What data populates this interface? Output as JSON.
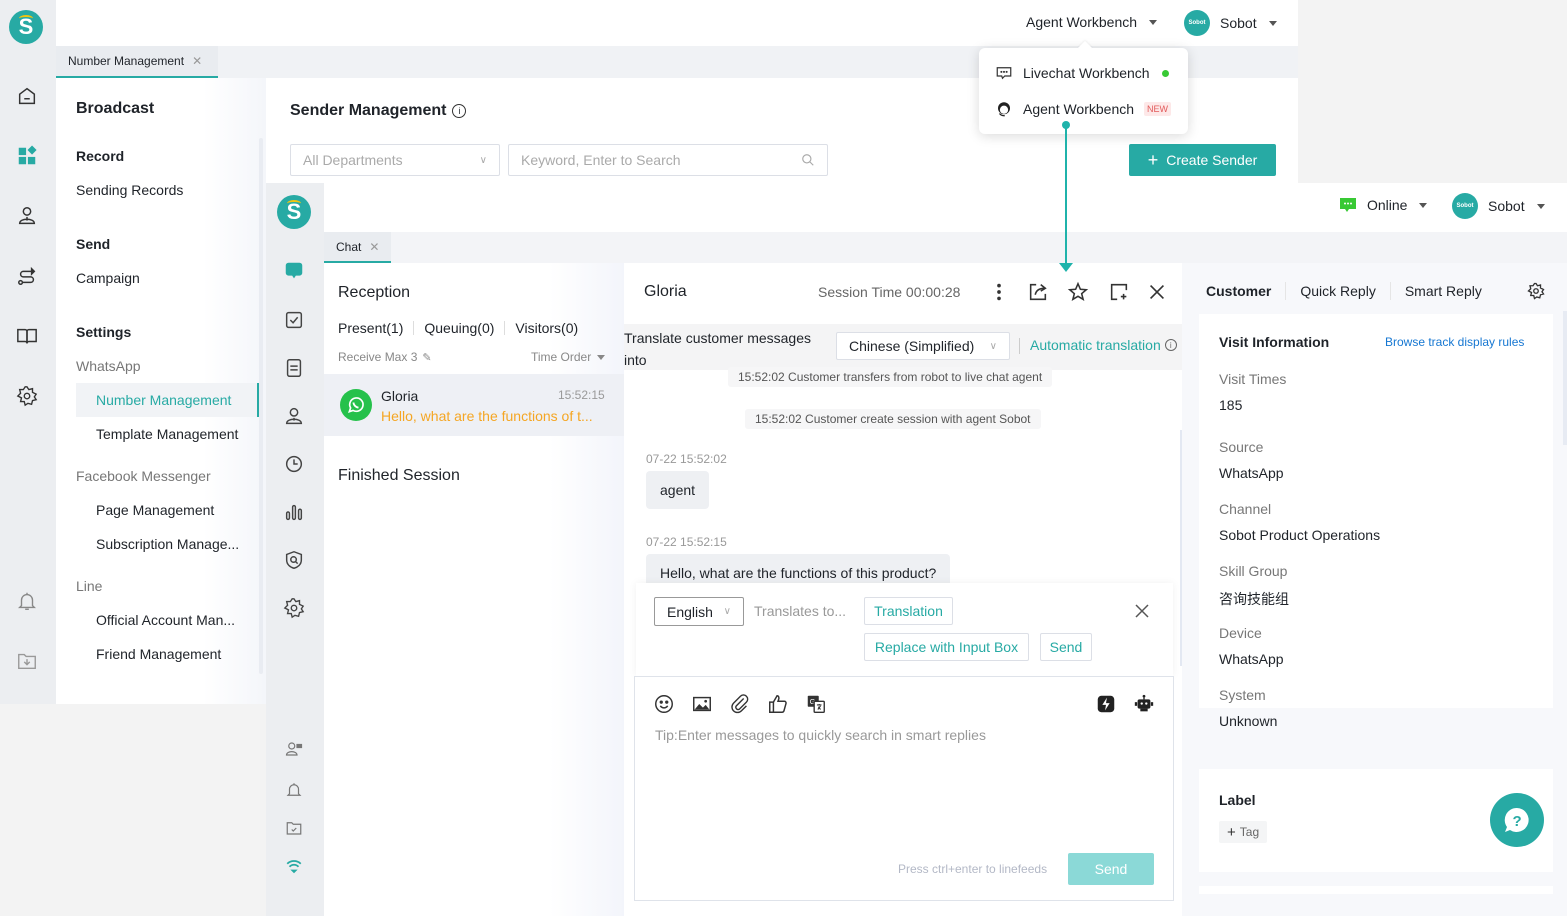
{
  "back_app": {
    "logo_letter": "S",
    "header": {
      "workspace_switch": "Agent Workbench",
      "user_name": "Sobot",
      "avatar_text": "Sobot"
    },
    "tab": {
      "label": "Number Management"
    },
    "nav": {
      "title": "Broadcast",
      "sections": [
        {
          "label": "Record",
          "items": [
            "Sending Records"
          ]
        },
        {
          "label": "Send",
          "items": [
            "Campaign"
          ]
        },
        {
          "label": "Settings"
        }
      ],
      "groups": [
        {
          "label": "WhatsApp",
          "items": [
            {
              "label": "Number Management",
              "active": true
            },
            {
              "label": "Template Management"
            }
          ]
        },
        {
          "label": "Facebook Messenger",
          "items": [
            {
              "label": "Page Management"
            },
            {
              "label": "Subscription Manage..."
            }
          ]
        },
        {
          "label": "Line",
          "items": [
            {
              "label": "Official Account Man..."
            },
            {
              "label": "Friend Management"
            }
          ]
        }
      ]
    },
    "rail_icons": [
      "home-icon",
      "apps-icon",
      "contacts-icon",
      "route-icon",
      "book-icon",
      "settings-icon",
      "bell-icon",
      "download-folder-icon"
    ],
    "main": {
      "title": "Sender Management",
      "department_select": "All Departments",
      "search_placeholder": "Keyword, Enter to Search",
      "create_button": "Create Sender"
    },
    "workspace_menu": {
      "items": [
        {
          "label": "Livechat Workbench",
          "status": "online"
        },
        {
          "label": "Agent Workbench",
          "badge": "NEW"
        }
      ]
    }
  },
  "workbench": {
    "logo_letter": "S",
    "header": {
      "status": "Online",
      "user_name": "Sobot",
      "avatar_text": "Sobot"
    },
    "tab": {
      "label": "Chat"
    },
    "reception": {
      "title": "Reception",
      "tabs": [
        "Present(1)",
        "Queuing(0)",
        "Visitors(0)"
      ],
      "receive_max": "Receive Max 3",
      "order": "Time Order",
      "sessions": [
        {
          "name": "Gloria",
          "time": "15:52:15",
          "preview": "Hello, what are the functions of t..."
        }
      ],
      "finished_title": "Finished Session"
    },
    "chat": {
      "customer_name": "Gloria",
      "session_time": "Session Time 00:00:28",
      "translate_label": "Translate customer messages into",
      "translate_target": "Chinese (Simplified)",
      "auto_translation": "Automatic translation",
      "system_messages": [
        "15:52:02 Customer transfers from robot to live chat agent",
        "15:52:02 Customer create session with agent Sobot"
      ],
      "messages": [
        {
          "time": "07-22 15:52:02",
          "text": "agent"
        },
        {
          "time": "07-22 15:52:15",
          "text": "Hello, what are the functions of this product?"
        }
      ],
      "translation_panel": {
        "source_lang": "English",
        "placeholder": "Translates to...",
        "translate_button": "Translation",
        "replace_button": "Replace with Input Box",
        "send_button": "Send"
      },
      "composer": {
        "placeholder": "Tip:Enter messages to quickly search in smart replies",
        "hint": "Press ctrl+enter to linefeeds",
        "send_button": "Send"
      }
    },
    "side": {
      "tabs": [
        "Customer",
        "Quick Reply",
        "Smart Reply"
      ],
      "visit": {
        "title": "Visit Information",
        "link": "Browse track display rules",
        "fields": [
          {
            "key": "Visit Times",
            "value": "185"
          },
          {
            "key": "Source",
            "value": "WhatsApp"
          },
          {
            "key": "Channel",
            "value": "Sobot Product Operations"
          },
          {
            "key": "Skill Group",
            "value": "咨询技能组"
          },
          {
            "key": "Device",
            "value": "WhatsApp"
          },
          {
            "key": "System",
            "value": "Unknown"
          }
        ]
      },
      "label": {
        "title": "Label",
        "add_tag": "Tag"
      }
    }
  },
  "colors": {
    "brand": "#27aaa4",
    "online": "#38c934",
    "whatsapp": "#25c14b",
    "link": "#1677d2",
    "preview": "#f5a623"
  }
}
